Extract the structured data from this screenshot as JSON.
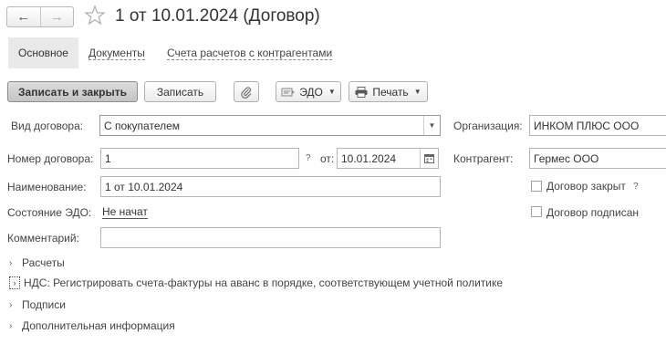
{
  "header": {
    "back_icon": "←",
    "forward_icon": "→",
    "title": "1 от 10.01.2024 (Договор)"
  },
  "tabs": [
    {
      "label": "Основное",
      "active": true
    },
    {
      "label": "Документы",
      "active": false
    },
    {
      "label": "Счета расчетов с контрагентами",
      "active": false
    }
  ],
  "toolbar": {
    "save_close_label": "Записать и закрыть",
    "save_label": "Записать",
    "edo_label": "ЭДО",
    "print_label": "Печать"
  },
  "form": {
    "contract_type_label": "Вид договора:",
    "contract_type_value": "С покупателем",
    "number_label": "Номер договора:",
    "number_value": "1",
    "number_hint": "?",
    "date_label": "от:",
    "date_value": "10.01.2024",
    "name_label": "Наименование:",
    "name_value": "1 от 10.01.2024",
    "edo_state_label": "Состояние ЭДО:",
    "edo_state_value": "Не начат",
    "comment_label": "Комментарий:",
    "comment_value": "",
    "org_label": "Организация:",
    "org_value": "ИНКОМ ПЛЮС ООО",
    "counterparty_label": "Контрагент:",
    "counterparty_value": "Гермес ООО",
    "closed_label": "Договор закрыт",
    "closed_hint": "?",
    "signed_label": "Договор подписан"
  },
  "groups": [
    {
      "label": "Расчеты",
      "chevron": "›"
    },
    {
      "label": "НДС: Регистрировать счета-фактуры на аванс в порядке, соответствующем учетной политике",
      "chevron": "›"
    },
    {
      "label": "Подписи",
      "chevron": "›"
    },
    {
      "label": "Дополнительная информация",
      "chevron": "›"
    }
  ]
}
